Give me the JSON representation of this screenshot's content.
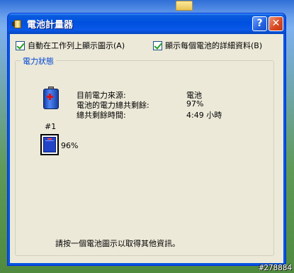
{
  "window": {
    "title": "電池計量器",
    "help_label": "?",
    "close_label": "✕"
  },
  "options": {
    "show_taskbar_icon": {
      "label": "自動在工作列上顯示圖示(A)",
      "checked": true
    },
    "show_battery_details": {
      "label": "顯示每個電池的詳細資料(B)",
      "checked": true
    }
  },
  "power_status": {
    "group_label": "電力狀態",
    "rows": [
      {
        "label": "目前電力來源:",
        "value": "電池"
      },
      {
        "label": "電池的電力總共剩餘:",
        "value": "97%"
      },
      {
        "label": "總共剩餘時間:",
        "value": "4:49 小時"
      }
    ],
    "battery": {
      "number": "#1",
      "percent": "96%",
      "level": 0.96
    }
  },
  "hint": "請按一個電池圖示以取得其他資訊。",
  "watermark": "#278884",
  "icons": {
    "title": "battery-meter-icon",
    "power_source": "battery-icon",
    "battery_1": "battery-level-icon"
  }
}
